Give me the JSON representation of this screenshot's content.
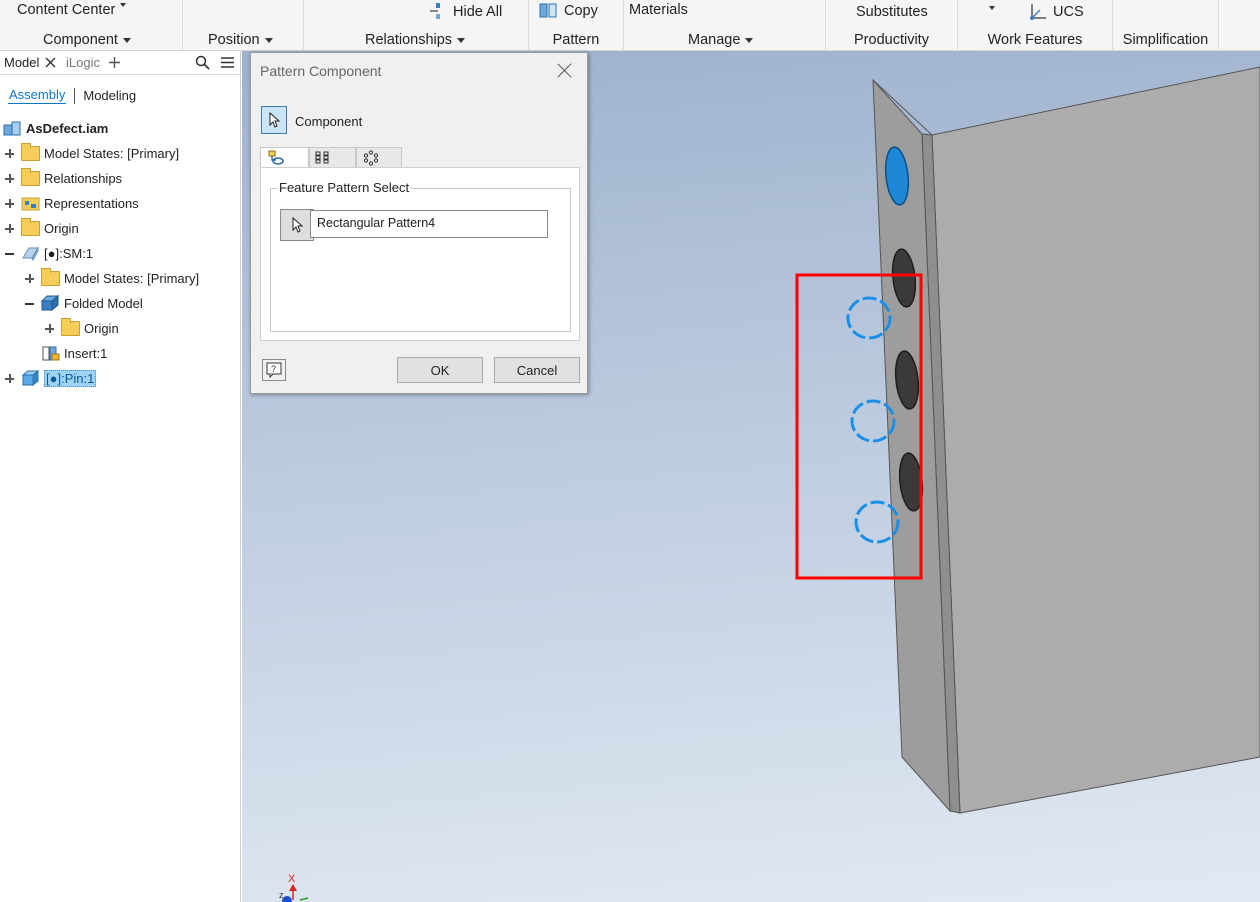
{
  "ribbon": {
    "content_center": "Content Center",
    "component": "Component",
    "position": "Position",
    "hide_all": "Hide All",
    "relationships": "Relationships",
    "copy": "Copy",
    "pattern": "Pattern",
    "materials": "Materials",
    "manage": "Manage",
    "substitutes": "Substitutes",
    "productivity": "Productivity",
    "ucs": "UCS",
    "work_features": "Work Features",
    "simplification": "Simplification"
  },
  "browser": {
    "tabs": [
      "Model",
      "iLogic"
    ],
    "subtabs": [
      "Assembly",
      "Modeling"
    ],
    "tree": [
      {
        "label": "AsDefect.iam"
      },
      {
        "label": "Model States: [Primary]"
      },
      {
        "label": "Relationships"
      },
      {
        "label": "Representations"
      },
      {
        "label": "Origin"
      },
      {
        "label": "[●]:SM:1"
      },
      {
        "label": "Model States: [Primary]"
      },
      {
        "label": "Folded Model"
      },
      {
        "label": "Origin"
      },
      {
        "label": "Insert:1"
      },
      {
        "label": "[●]:Pin:1"
      }
    ]
  },
  "dialog": {
    "title": "Pattern Component",
    "component_label": "Component",
    "group_title": "Feature Pattern Select",
    "feature_value": "Rectangular Pattern4",
    "ok": "OK",
    "cancel": "Cancel"
  },
  "triad": {
    "x_label": "X"
  },
  "colors": {
    "accent": "#0b78c5",
    "highlight_box": "#ff0000",
    "preview_circles": "#1a8fe8"
  }
}
